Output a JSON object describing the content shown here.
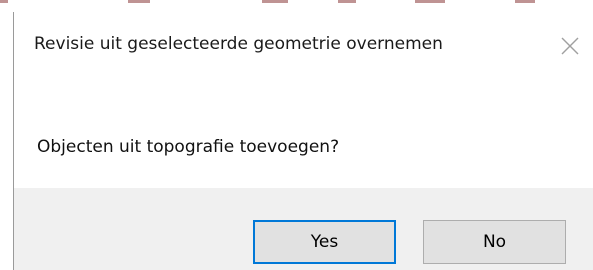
{
  "dialog": {
    "title": "Revisie uit geselecteerde geometrie overnemen",
    "close_icon": "close-icon",
    "message": "Objecten uit topografie toevoegen?",
    "buttons": {
      "yes_label": "Yes",
      "no_label": "No"
    },
    "default_button": "yes"
  },
  "colors": {
    "footer_background": "#f0f0f0",
    "button_face": "#e1e1e1",
    "focus_border": "#0078d7"
  }
}
